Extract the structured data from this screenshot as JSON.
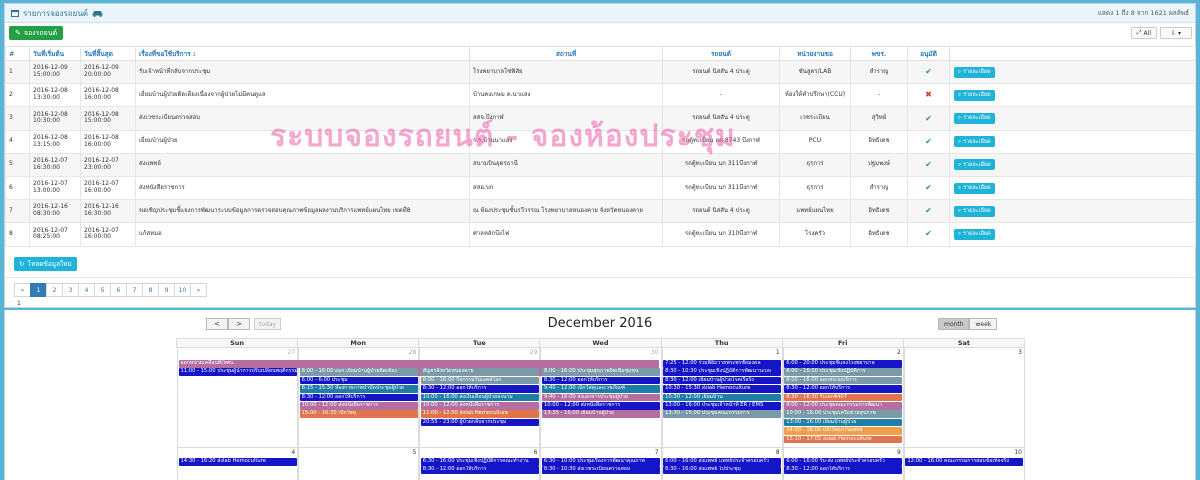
{
  "header": {
    "title": "รายการจองรถยนต์",
    "summary": "แสดง 1 ถึง 8 จาก 1621 ผลลัพธ์"
  },
  "toolbar": {
    "new_label": "จองรถยนต์",
    "all_label": "All"
  },
  "table": {
    "headers": [
      "#",
      "วันที่เริ่มต้น",
      "วันที่สิ้นสุด",
      "เรื่องที่ขอใช้บริการ :",
      "สถานที่",
      "รถยนต์",
      "หน่วยงานขอ",
      "พขร.",
      "อนุมัติ",
      ""
    ],
    "detail_label": "รายละเอียด",
    "rows": [
      {
        "no": "1",
        "start": "2016-12-09 15:00:00",
        "end": "2016-12-09 20:00:00",
        "subject": "รับเจ้าหน้าที่กลับจากประชุม",
        "place": "โรงพยาบาลโซ่พิสัย",
        "car": "รถยนต์ นิสสัน 4 ประตู",
        "dept": "ชันสูตร/LAB",
        "driver": "สำราญ",
        "approved": "yes"
      },
      {
        "no": "2",
        "start": "2016-12-08 13:30:00",
        "end": "2016-12-08 16:00:00",
        "subject": "เยี่ยมบ้านผู้ป่วยติดเตียงเนื่องจากผู้ป่วยไม่มีคนดูแล",
        "place": "บ้านคงเกษม ต.นาแสง",
        "car": "-",
        "dept": "ห้องให้คำปรึกษา(CCU)",
        "driver": "-",
        "approved": "no"
      },
      {
        "no": "3",
        "start": "2016-12-08 10:30:00",
        "end": "2016-12-08 15:00:00",
        "subject": "ส่งเวชระเบียนตรวจสอบ",
        "place": "สสจ.บึงกาฬ",
        "car": "รถยนต์ นิสสัน 4 ประตู",
        "dept": "เวชระเบียน",
        "driver": "สุวิทย์",
        "approved": "yes"
      },
      {
        "no": "4",
        "start": "2016-12-08 13:15:00",
        "end": "2016-12-08 16:00:00",
        "subject": "เยี่ยมบ้านผู้ป่วย",
        "place": "ร.ร.บ้านนาแสง",
        "car": "รถตู้ทะเบียน ฮต 8743 บึงกาฬ",
        "dept": "PCU",
        "driver": "อิทธิเดช",
        "approved": "yes"
      },
      {
        "no": "5",
        "start": "2016-12-07 16:30:00",
        "end": "2016-12-07 23:00:00",
        "subject": "ส่งแพทย์",
        "place": "สนามบินอุดรธานี",
        "car": "รถตู้ทะเบียน นก 311บึงกาฬ",
        "dept": "ธุรการ",
        "driver": "ปฐมพงษ์",
        "approved": "yes"
      },
      {
        "no": "6",
        "start": "2016-12-07 13:00:00",
        "end": "2016-12-07 16:00:00",
        "subject": "ส่งหนังสือราชการ",
        "place": "สสอ.บก",
        "car": "รถตู้ทะเบียน นก 311บึงกาฬ",
        "dept": "ธุรการ",
        "driver": "สำราญ",
        "approved": "yes"
      },
      {
        "no": "7",
        "start": "2016-12-16 08:30:00",
        "end": "2016-12-16 16:30:00",
        "subject": "ขอเชิญประชุมชี้แจงการพัฒนาระบบข้อมูลการตรวจสอบคุณภาพข้อมูลผลงานบริการแพทย์แผนไทย เขตที่8",
        "place": "ณ ห้องประชุมชั้นรวีวรรณ โรงพยาบาลหนองคาย จังหวัดหนองคาย",
        "car": "รถยนต์ นิสสัน 4 ประตู",
        "dept": "แพทย์แผนไทย",
        "driver": "อิทธิเดช",
        "approved": "yes"
      },
      {
        "no": "8",
        "start": "2016-12-07 08:25:00",
        "end": "2016-12-07 16:00:00",
        "subject": "แก้สหมอ",
        "place": "ศาลหลักบึงไฟ",
        "car": "รถตู้ทะเบียน นก 310บึงกาฬ",
        "dept": "โรงครัว",
        "driver": "อิทธิเดช",
        "approved": "yes"
      }
    ]
  },
  "reload_label": "โหลดข้อมูลใหม่",
  "pagination": {
    "prev": "«",
    "next": "»",
    "pages": [
      "1",
      "2",
      "3",
      "4",
      "5",
      "6",
      "7",
      "8",
      "9",
      "10"
    ],
    "current": "1",
    "current_text": "1"
  },
  "watermark": "ระบบจองรถยนต์ - จองห้องประชุม",
  "calendar": {
    "title": "December 2016",
    "prev": "<",
    "next": ">",
    "today": "today",
    "views": [
      "month",
      "week"
    ],
    "days": [
      "Sun",
      "Mon",
      "Tue",
      "Wed",
      "Thu",
      "Fri",
      "Sat"
    ],
    "week1": {
      "dates": [
        "27",
        "28",
        "29",
        "30",
        "1",
        "2",
        "3"
      ],
      "events": [
        {
          "col": 0,
          "span": 3.99,
          "row": 0,
          "text": "ออกหน่วยเคลื่อนที่(ทศบ.",
          "color": "#b46fa0"
        },
        {
          "col": 1,
          "span": 3,
          "row": 1,
          "text": "",
          "color": "#b46fa0"
        },
        {
          "col": 0,
          "span": 1,
          "row": 1,
          "text": "11:00 - 15:00 ประชุมผู้นำการปรับเปลี่ยนพฤติกรรม",
          "color": "#1515c8"
        },
        {
          "col": 1,
          "span": 1,
          "row": 1,
          "text": "8:00 - 16:00 ออก เยี่ยมบ้านผู้ป่วยติดเตียง",
          "color": "#7a9aa8"
        },
        {
          "col": 2,
          "span": 1,
          "row": 1,
          "text": "สัญจรจังหวัดหนองคาย",
          "color": "#7a9aa8"
        },
        {
          "col": 3,
          "span": 1,
          "row": 1,
          "text": "8:00 - 16:00 ประชุมสุขภาพจิตเพื่อชุมชน",
          "color": "#7a9aa8"
        },
        {
          "col": 1,
          "span": 1,
          "row": 2,
          "text": "6:00 - 6:00 ประชุม",
          "color": "#1515c8"
        },
        {
          "col": 1,
          "span": 1,
          "row": 3,
          "text": "8:15 - 15:30 ห้องกายภาพบำบัดประชุมผู้ป่วย",
          "color": "#1e7ea6"
        },
        {
          "col": 1,
          "span": 1,
          "row": 4,
          "text": "8:30 - 12:00 ออกให้บริการ",
          "color": "#1515c8"
        },
        {
          "col": 1,
          "span": 1,
          "row": 5,
          "text": "10:00 - 12:00 ส่งหนังสือราชการ",
          "color": "#b46fa0"
        },
        {
          "col": 1,
          "span": 1,
          "row": 6,
          "text": "15:00 - 16:30 เบิกวัสดุ",
          "color": "#e0744d"
        },
        {
          "col": 2,
          "span": 1,
          "row": 2,
          "text": "8:00 - 16:00 กิจกรรมวันเอดส์โลก",
          "color": "#7a9aa8"
        },
        {
          "col": 2,
          "span": 1,
          "row": 3,
          "text": "8:30 - 12:00 ออกให้บริการ",
          "color": "#1515c8"
        },
        {
          "col": 2,
          "span": 1,
          "row": 4,
          "text": "10:00 - 16:00 ส่งเงินเดือนผู้ป่วยลงนาม",
          "color": "#1e7ea6"
        },
        {
          "col": 2,
          "span": 1,
          "row": 5,
          "text": "10:00 - 12:00 ส่งหนังสือราชการ",
          "color": "#b46fa0"
        },
        {
          "col": 2,
          "span": 1,
          "row": 6,
          "text": "11:00 - 12:50 ส่งlab Hemoculture",
          "color": "#e0744d"
        },
        {
          "col": 2,
          "span": 1,
          "row": 7,
          "text": "20:55 - 23:00 ผู้ป่วยกลับจากประชุม",
          "color": "#1515c8"
        },
        {
          "col": 3,
          "span": 1,
          "row": 2,
          "text": "8:30 - 12:00 ออกให้บริการ",
          "color": "#1515c8"
        },
        {
          "col": 3,
          "span": 1,
          "row": 3,
          "text": "9:40 - 12:00 เบิกวัสดุและเวชภัณฑ์",
          "color": "#1e7ea6"
        },
        {
          "col": 3,
          "span": 1,
          "row": 4,
          "text": "9:40 - 16:00 ส่งเอกสารประชุมผู้ป่วย",
          "color": "#b46fa0"
        },
        {
          "col": 3,
          "span": 1,
          "row": 5,
          "text": "10:00 - 12:00 ส่งหนังสือราชการ",
          "color": "#1515c8"
        },
        {
          "col": 3,
          "span": 1,
          "row": 6,
          "text": "13:35 - 16:00 เยี่ยมบ้านผู้ป่วย",
          "color": "#b46fa0"
        },
        {
          "col": 4,
          "span": 1,
          "row": 0,
          "text": "7:25 - 12:00 ร่วมพิธีถวายพระพรชัยมงคล",
          "color": "#1515c8"
        },
        {
          "col": 4,
          "span": 1,
          "row": 1,
          "text": "8:30 - 10:30 ประชุมเชิงปฏิบัติการพัฒนาระบบ",
          "color": "#1515c8"
        },
        {
          "col": 4,
          "span": 1,
          "row": 2,
          "text": "8:30 - 12:00 เยี่ยมบ้านผู้ป่วยโรคเรื้อรัง",
          "color": "#1515c8"
        },
        {
          "col": 4,
          "span": 1,
          "row": 3,
          "text": "10:30 - 15:30 ส่งlab Hemoculture",
          "color": "#1515c8"
        },
        {
          "col": 4,
          "span": 1,
          "row": 4,
          "text": "10:30 - 12:00 เยี่ยมบ้าน",
          "color": "#1e7ea6"
        },
        {
          "col": 4,
          "span": 1,
          "row": 5,
          "text": "13:00 - 16:00 ประชุมเจ้าหน้าที่ ER / EMS",
          "color": "#1515c8"
        },
        {
          "col": 4,
          "span": 1,
          "row": 6,
          "text": "13:30 - 15:00 ประชุมคณะกรรมการ",
          "color": "#7a9aa8"
        },
        {
          "col": 5,
          "span": 1,
          "row": 0,
          "text": "6:00 - 20:00 ประชุมชี้แจงโรงพยาบาล",
          "color": "#1515c8"
        },
        {
          "col": 5,
          "span": 1,
          "row": 1,
          "text": "8:00 - 16:00 ประชุมเชิงปฏิบัติการ",
          "color": "#7a9aa8"
        },
        {
          "col": 5,
          "span": 1,
          "row": 2,
          "text": "8:00 - 16:00 ออกหน่วยบริการ",
          "color": "#7a9aa8"
        },
        {
          "col": 5,
          "span": 1,
          "row": 3,
          "text": "8:30 - 12:00 ออกให้บริการ",
          "color": "#1515c8"
        },
        {
          "col": 5,
          "span": 1,
          "row": 4,
          "text": "8:30 - 16:30 รับเอ็กซ์407",
          "color": "#e0744d"
        },
        {
          "col": 5,
          "span": 1,
          "row": 5,
          "text": "9:00 - 12:00 ประชุมคณะกรรมการพัฒนา",
          "color": "#b46fa0"
        },
        {
          "col": 5,
          "span": 1,
          "row": 6,
          "text": "10:00 - 16:00 ประชุมเครือข่ายสุขภาพ",
          "color": "#7a9aa8"
        },
        {
          "col": 5,
          "span": 1,
          "row": 7,
          "text": "13:00 - 16:00 เยี่ยมบ้านผู้ป่วย",
          "color": "#1e7ea6"
        },
        {
          "col": 5,
          "span": 1,
          "row": 8,
          "text": "14:00 - 16:00 เบิกวัสดุการแพทย์",
          "color": "#f0a04b"
        },
        {
          "col": 5,
          "span": 1,
          "row": 9,
          "text": "15:10 - 17:05 ส่งlab Hemoculture",
          "color": "#e0744d"
        }
      ]
    },
    "week2": {
      "dates": [
        "4",
        "5",
        "6",
        "7",
        "8",
        "9",
        "10"
      ],
      "events": [
        {
          "col": 0,
          "span": 1,
          "row": 0,
          "text": "14:30 - 16:20 ส่งlab Hemoculture",
          "color": "#1515c8"
        },
        {
          "col": 2,
          "span": 1,
          "row": 0,
          "text": "6:30 - 16:00 ประชุมเชิงปฏิบัติการคณะทำงาน",
          "color": "#1515c8"
        },
        {
          "col": 2,
          "span": 1,
          "row": 1,
          "text": "8:30 - 12:00 ออกให้บริการ",
          "color": "#1515c8"
        },
        {
          "col": 3,
          "span": 1,
          "row": 0,
          "text": "6:30 - 10:00 ประชุมเรื่องการพัฒนาคุณภาพ",
          "color": "#1515c8"
        },
        {
          "col": 3,
          "span": 1,
          "row": 1,
          "text": "8:30 - 10:30 ส่งเวชระเบียนตรวจสอบ",
          "color": "#1515c8"
        },
        {
          "col": 4,
          "span": 1,
          "row": 0,
          "text": "6:00 - 16:00 ส่งแพทย์ แพทย์ประจำครอบครัว",
          "color": "#1515c8"
        },
        {
          "col": 4,
          "span": 1,
          "row": 1,
          "text": "6:30 - 16:00 ส่งแพทย์ ไปประชุม",
          "color": "#1515c8"
        },
        {
          "col": 5,
          "span": 1,
          "row": 0,
          "text": "6:00 - 16:00 รับ-ส่ง แพทย์ประจำครอบครัว",
          "color": "#1515c8"
        },
        {
          "col": 5,
          "span": 1,
          "row": 1,
          "text": "8:30 - 12:00 ออกให้บริการ",
          "color": "#1515c8"
        },
        {
          "col": 6,
          "span": 1,
          "row": 0,
          "text": "12:00 - 16:00 คณะกรรมการสอบข้อเท็จจริง",
          "color": "#1515c8"
        }
      ]
    }
  },
  "colors": {
    "background": "#5ab4d6",
    "primary": "#337ab7",
    "success": "#22a043",
    "info": "#1fb3d8",
    "approved": "#26a541",
    "rejected": "#d9312b",
    "watermark": "#ec5ca8"
  }
}
